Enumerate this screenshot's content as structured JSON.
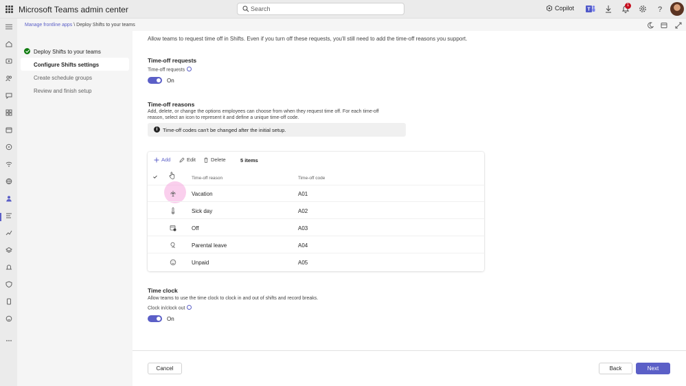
{
  "topbar": {
    "app_title": "Microsoft Teams admin center",
    "search_placeholder": "Search",
    "copilot_label": "Copilot",
    "notification_count": "1"
  },
  "breadcrumb": {
    "parent": "Manage frontline apps",
    "separator": "\\",
    "current": "Deploy Shifts to your teams"
  },
  "steps": [
    {
      "label": "Deploy Shifts to your teams",
      "state": "complete"
    },
    {
      "label": "Configure Shifts settings",
      "state": "active"
    },
    {
      "label": "Create schedule groups",
      "state": "upcoming"
    },
    {
      "label": "Review and finish setup",
      "state": "upcoming"
    }
  ],
  "main": {
    "intro": "Allow teams to request time off in Shifts. Even if you turn off these requests, you'll still need to add the time-off reasons you support.",
    "time_off_requests": {
      "heading": "Time-off requests",
      "label": "Time-off requests",
      "toggle_state": "On"
    },
    "time_off_reasons": {
      "heading": "Time-off reasons",
      "description": "Add, delete, or change the options employees can choose from when they request time off. For each time-off reason, select an icon to represent it and define a unique time-off code.",
      "notice": "Time-off codes can't be changed after the initial setup.",
      "toolbar": {
        "add": "Add",
        "edit": "Edit",
        "delete": "Delete",
        "count": "5 items"
      },
      "columns": {
        "reason": "Time-off reason",
        "code": "Time-off code"
      },
      "rows": [
        {
          "icon": "airplane-icon",
          "reason": "Vacation",
          "code": "A01"
        },
        {
          "icon": "thermometer-icon",
          "reason": "Sick day",
          "code": "A02"
        },
        {
          "icon": "calendar-off-icon",
          "reason": "Off",
          "code": "A03"
        },
        {
          "icon": "baby-bottle-icon",
          "reason": "Parental leave",
          "code": "A04"
        },
        {
          "icon": "smile-icon",
          "reason": "Unpaid",
          "code": "A05"
        }
      ]
    },
    "time_clock": {
      "heading": "Time clock",
      "description": "Allow teams to use the time clock to clock in and out of shifts and record breaks.",
      "label": "Clock in/clock out",
      "toggle_state": "On"
    }
  },
  "footer": {
    "cancel": "Cancel",
    "back": "Back",
    "next": "Next"
  },
  "colors": {
    "accent": "#5b5fc7",
    "success": "#107c10",
    "badge": "#c50f1f"
  }
}
